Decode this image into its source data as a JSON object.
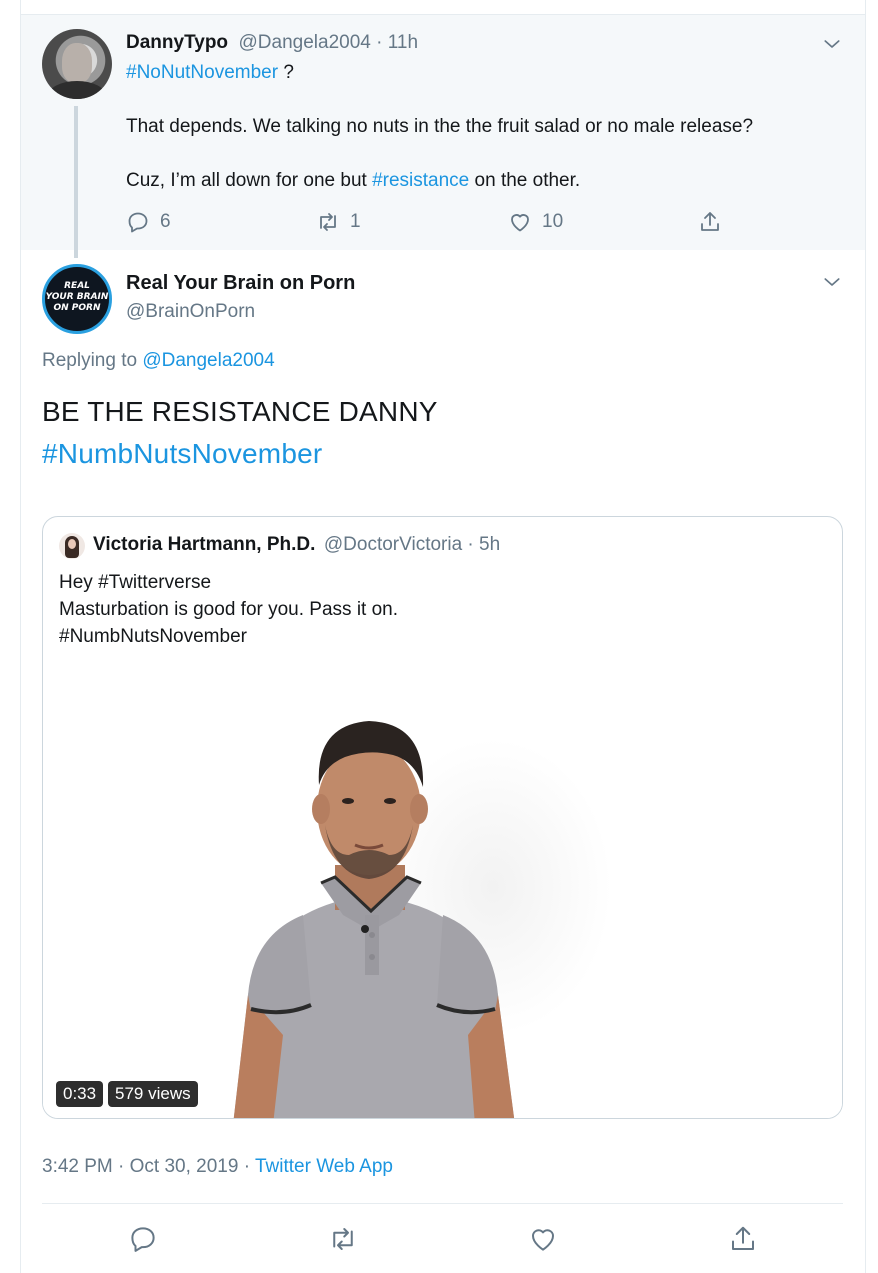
{
  "parent_tweet": {
    "display_name": "DannyTypo",
    "handle": "@Dangela2004",
    "separator": " · ",
    "time": "11h",
    "hashtag_line": {
      "hashtag": "#NoNutNovember",
      "suffix": " ?"
    },
    "body_line_1": "That depends. We talking no nuts in the the fruit salad or no male release?",
    "body_line_2": {
      "prefix": "Cuz, I’m all down for one but ",
      "hashtag": "#resistance",
      "suffix": " on the other."
    },
    "actions": {
      "reply_count": "6",
      "retweet_count": "1",
      "like_count": "10"
    },
    "menu_icon": "chevron-down-icon"
  },
  "main_tweet": {
    "avatar_logo_lines": [
      "REAL",
      "YOUR BRAIN",
      "ON PORN"
    ],
    "display_name": "Real Your Brain on Porn",
    "handle": "@BrainOnPorn",
    "replying_prefix": "Replying to ",
    "replying_to": "@Dangela2004",
    "text_line_1": "BE THE RESISTANCE DANNY",
    "text_line_2": "#NumbNutsNovember",
    "menu_icon": "chevron-down-icon",
    "quoted_tweet": {
      "display_name": "Victoria Hartmann, Ph.D.",
      "handle": "@DoctorVictoria",
      "separator": " · ",
      "time": "5h",
      "lines": [
        "Hey #Twitterverse",
        "Masturbation is good for you. Pass it on.",
        "#NumbNutsNovember"
      ],
      "video": {
        "duration": "0:33",
        "views": "579 views"
      }
    },
    "timestamp": "3:42 PM · Oct 30, 2019 · ",
    "source": "Twitter Web App",
    "actions": [
      "reply-icon",
      "retweet-icon",
      "like-icon",
      "share-icon"
    ]
  },
  "colors": {
    "link": "#1b95e0",
    "secondary_text": "#657786",
    "primary_text": "#14171a",
    "parent_background": "#f5f8fa",
    "border": "#e6ecf0"
  }
}
